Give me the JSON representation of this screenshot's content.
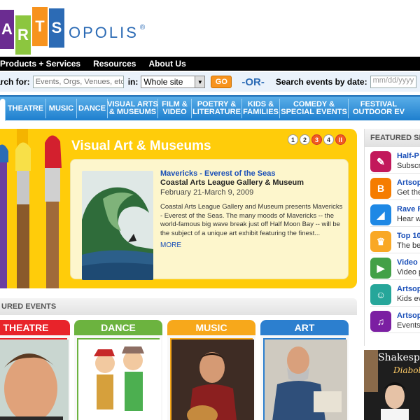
{
  "logo": {
    "letters": [
      "A",
      "R",
      "T",
      "S"
    ],
    "rest": "OPOLIS",
    "reg": "®",
    "colors": [
      "#6b2c91",
      "#8cc63f",
      "#f7931e",
      "#2c6bb5"
    ]
  },
  "topnav": {
    "items": [
      "Products + Services",
      "Resources",
      "About Us"
    ]
  },
  "search": {
    "label": "arch for:",
    "placeholder": "Events, Orgs, Venues, etc",
    "in_label": "in:",
    "scope_value": "Whole site",
    "go_label": "GO",
    "or_label": "-OR-",
    "date_label": "Search events by date:",
    "date_placeholder": "mm/dd/yyyy"
  },
  "categories": [
    {
      "label": "THEATRE",
      "active": false
    },
    {
      "label": "MUSIC",
      "active": false
    },
    {
      "label": "DANCE",
      "active": false
    },
    {
      "label": "VISUAL ARTS\n& MUSEUMS",
      "active": false
    },
    {
      "label": "FILM &\nVIDEO",
      "active": false
    },
    {
      "label": "POETRY &\nLITERATURE",
      "active": false
    },
    {
      "label": "KIDS &\nFAMILIES",
      "active": false
    },
    {
      "label": "COMEDY &\nSPECIAL EVENTS",
      "active": false
    },
    {
      "label": "FESTIVAL\nOUTDOOR EV",
      "active": false
    }
  ],
  "feature": {
    "title": "Visual Art & Museums",
    "pager": [
      "1",
      "2",
      "3",
      "4",
      "II"
    ],
    "active_page": "3",
    "event_title": "Mavericks - Everest of the Seas",
    "venue": "Coastal Arts League Gallery & Museum",
    "date": "February 21-March 9, 2009",
    "description": "Coastal Arts League Gallery and Museum presents Mavericks - Everest of the Seas. The many moods of Mavericks -- the world-famous big wave break just off Half Moon Bay -- will be the subject of a unique art exhibit featuring the finest...",
    "more": "MORE"
  },
  "events": {
    "header": "URED EVENTS",
    "cards": [
      {
        "label": "THEATRE",
        "color": "#e8232a"
      },
      {
        "label": "DANCE",
        "color": "#6cb33f"
      },
      {
        "label": "MUSIC",
        "color": "#f7a81b"
      },
      {
        "label": "ART",
        "color": "#2c7fcf"
      }
    ]
  },
  "sidebar": {
    "header": "FEATURED SE",
    "items": [
      {
        "title": "Half-P",
        "sub": "Subscr",
        "icon": "ticket-icon",
        "color": "#c2185b"
      },
      {
        "title": "Artsop",
        "sub": "Get the",
        "icon": "blogger-icon",
        "color": "#f57c00"
      },
      {
        "title": "Rave R",
        "sub": "Hear w",
        "icon": "megaphone-icon",
        "color": "#1e88e5"
      },
      {
        "title": "Top 10",
        "sub": "The be",
        "icon": "trophy-icon",
        "color": "#f9a825"
      },
      {
        "title": "Video",
        "sub": "Video p",
        "icon": "video-camera-icon",
        "color": "#43a047"
      },
      {
        "title": "Artsop",
        "sub": "Kids ev",
        "icon": "kids-icon",
        "color": "#26a69a"
      },
      {
        "title": "Artsop",
        "sub": "Events",
        "icon": "film-icon",
        "color": "#7b1fa2"
      }
    ]
  },
  "promo": {
    "title": "Shakesp",
    "subtitle": "Diabol"
  }
}
